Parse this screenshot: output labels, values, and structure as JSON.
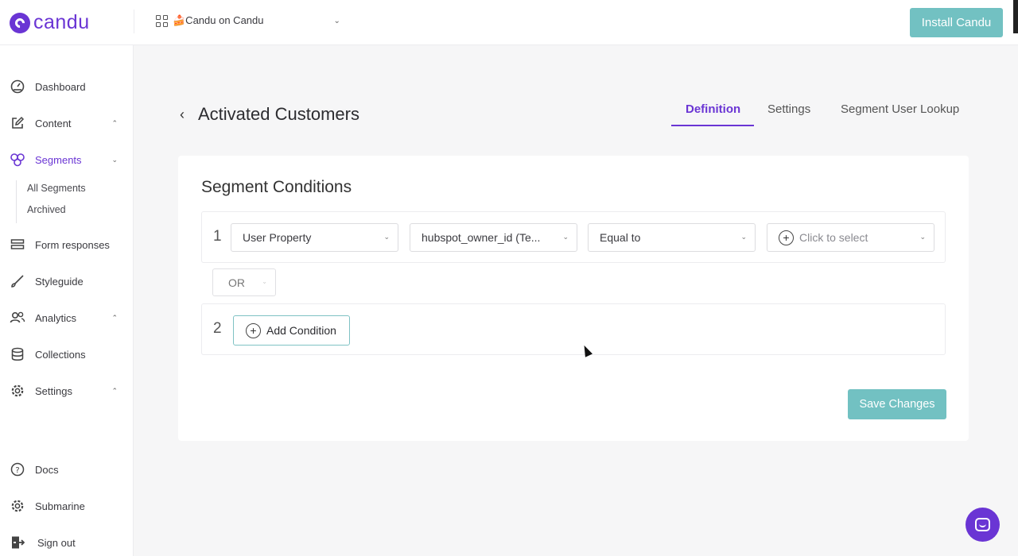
{
  "app": {
    "brand": "candu",
    "workspace": "🍰Candu on Candu",
    "install_label": "Install Candu"
  },
  "sidebar": {
    "items": [
      {
        "label": "Dashboard",
        "icon": "dashboard-icon"
      },
      {
        "label": "Content",
        "icon": "edit-icon"
      },
      {
        "label": "Segments",
        "icon": "segments-icon"
      },
      {
        "label": "Form responses",
        "icon": "form-icon"
      },
      {
        "label": "Styleguide",
        "icon": "brush-icon"
      },
      {
        "label": "Analytics",
        "icon": "users-icon"
      },
      {
        "label": "Collections",
        "icon": "database-icon"
      },
      {
        "label": "Settings",
        "icon": "gear-icon"
      }
    ],
    "segments_sub": [
      "All Segments",
      "Archived"
    ],
    "bottom": [
      {
        "label": "Docs",
        "icon": "help-icon"
      },
      {
        "label": "Submarine",
        "icon": "gear-icon"
      },
      {
        "label": "Sign out",
        "icon": "sign-out-icon"
      }
    ]
  },
  "page": {
    "title": "Activated Customers",
    "tabs": [
      "Definition",
      "Settings",
      "Segment User Lookup"
    ],
    "active_tab": "Definition"
  },
  "conditions": {
    "heading": "Segment Conditions",
    "rows": [
      {
        "number": "1",
        "property_type": "User Property",
        "property_name": "hubspot_owner_id (Te...",
        "operator": "Equal to",
        "value_placeholder": "Click to select"
      },
      {
        "number": "2",
        "add_label": "Add Condition"
      }
    ],
    "joiner": "OR",
    "save_label": "Save Changes"
  },
  "colors": {
    "brand": "#6a35d4",
    "teal": "#72c1c2"
  }
}
